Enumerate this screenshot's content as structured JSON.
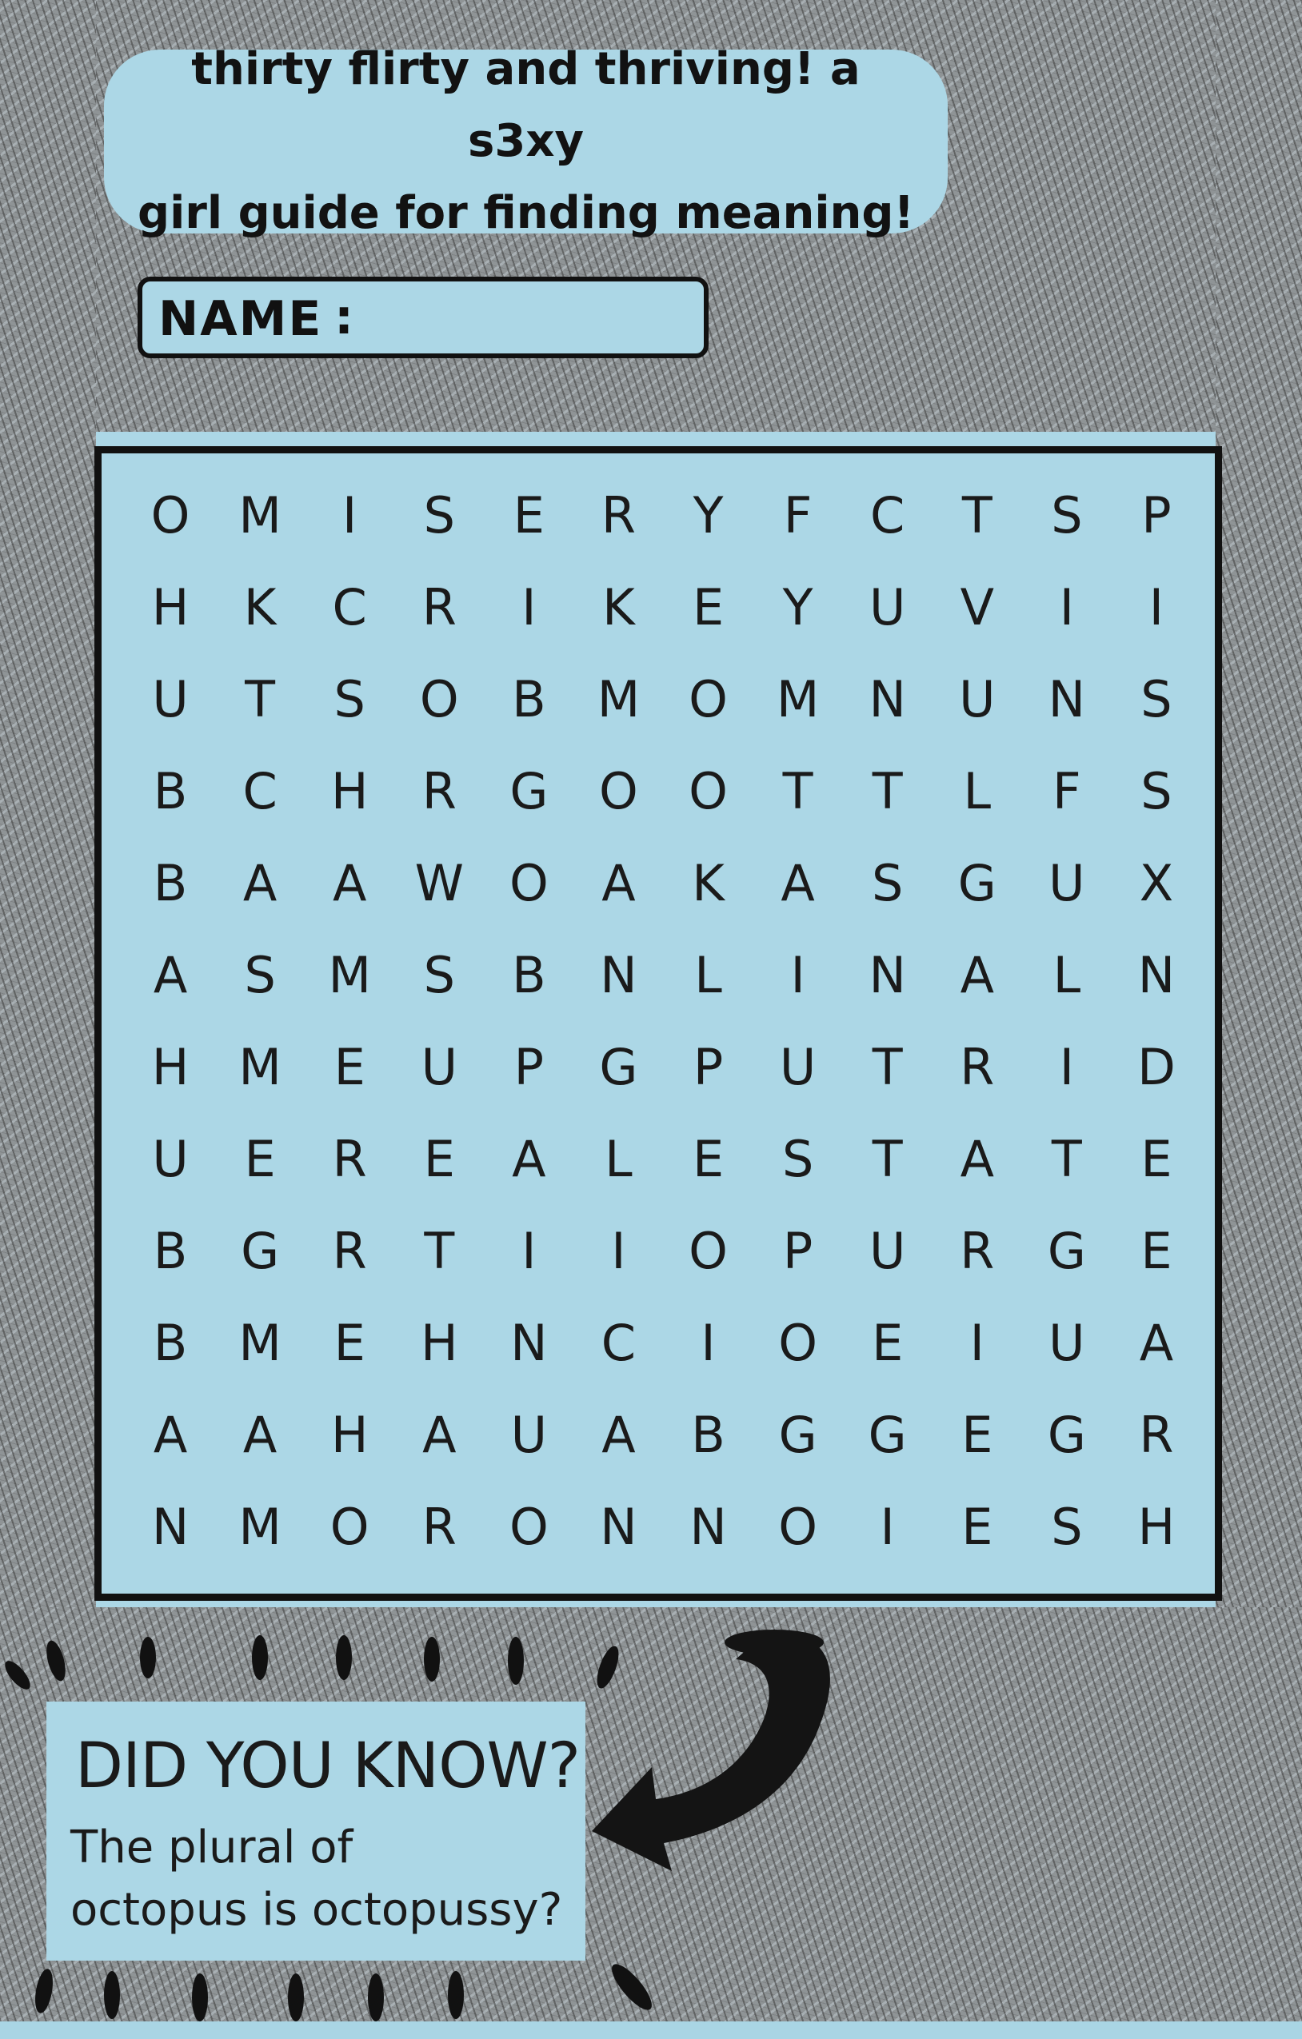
{
  "title": {
    "line1": "thirty flirty and thriving! a s3xy",
    "line2": "girl guide for finding meaning!"
  },
  "name_field": {
    "label": "NAME",
    "colon": ":",
    "value": ""
  },
  "grid": [
    [
      "O",
      "M",
      "I",
      "S",
      "E",
      "R",
      "Y",
      "F",
      "C",
      "T",
      "S",
      "P"
    ],
    [
      "H",
      "K",
      "C",
      "R",
      "I",
      "K",
      "E",
      "Y",
      "U",
      "V",
      "I",
      "I"
    ],
    [
      "U",
      "T",
      "S",
      "O",
      "B",
      "M",
      "O",
      "M",
      "N",
      "U",
      "N",
      "S"
    ],
    [
      "B",
      "C",
      "H",
      "R",
      "G",
      "O",
      "O",
      "T",
      "T",
      "L",
      "F",
      "S"
    ],
    [
      "B",
      "A",
      "A",
      "W",
      "O",
      "A",
      "K",
      "A",
      "S",
      "G",
      "U",
      "X"
    ],
    [
      "A",
      "S",
      "M",
      "S",
      "B",
      "N",
      "L",
      "I",
      "N",
      "A",
      "L",
      "N"
    ],
    [
      "H",
      "M",
      "E",
      "U",
      "P",
      "G",
      "P",
      "U",
      "T",
      "R",
      "I",
      "D"
    ],
    [
      "U",
      "E",
      "R",
      "E",
      "A",
      "L",
      "E",
      "S",
      "T",
      "A",
      "T",
      "E"
    ],
    [
      "B",
      "G",
      "R",
      "T",
      "I",
      "I",
      "O",
      "P",
      "U",
      "R",
      "G",
      "E"
    ],
    [
      "B",
      "M",
      "E",
      "H",
      "N",
      "C",
      "I",
      "O",
      "E",
      "I",
      "U",
      "A"
    ],
    [
      "A",
      "A",
      "H",
      "A",
      "U",
      "A",
      "B",
      "G",
      "G",
      "E",
      "G",
      "R"
    ],
    [
      "N",
      "M",
      "O",
      "R",
      "O",
      "N",
      "N",
      "O",
      "I",
      "E",
      "S",
      "H"
    ]
  ],
  "did_you_know": {
    "heading": "DID YOU KNOW?",
    "line1": "The plural of",
    "line2": "octopus is octopussy?"
  },
  "colors": {
    "paper": "#acd7e6",
    "graphite": "#8f9496",
    "ink": "#111111"
  },
  "icons": [
    "curved-arrow-icon"
  ]
}
